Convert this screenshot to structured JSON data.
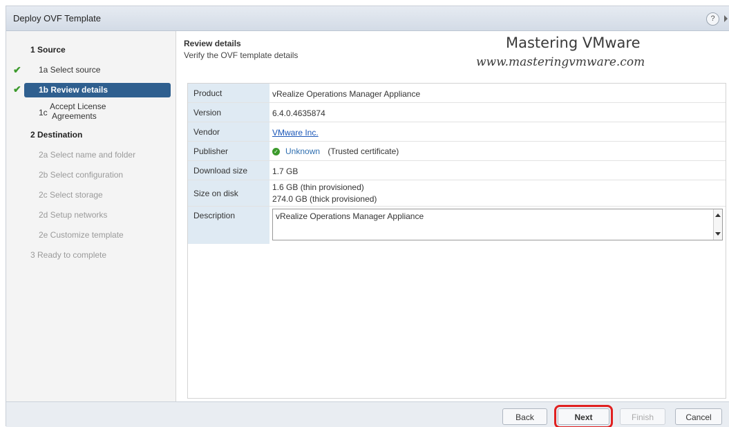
{
  "window": {
    "title": "Deploy OVF Template",
    "help_icon": "?"
  },
  "sidebar": {
    "items": [
      {
        "label": "1 Source",
        "checked": false,
        "state": "section"
      },
      {
        "label": "1a Select source",
        "checked": true,
        "state": "done"
      },
      {
        "label": "1b Review details",
        "checked": true,
        "state": "selected"
      },
      {
        "label_prefix": "1c",
        "label_line1": "Accept License",
        "label_line2": "Agreements",
        "checked": false,
        "state": "active"
      },
      {
        "label": "2 Destination",
        "checked": false,
        "state": "section"
      },
      {
        "label": "2a Select name and folder",
        "state": "disabled"
      },
      {
        "label": "2b Select configuration",
        "state": "disabled"
      },
      {
        "label": "2c Select storage",
        "state": "disabled"
      },
      {
        "label": "2d Setup networks",
        "state": "disabled"
      },
      {
        "label": "2e Customize template",
        "state": "disabled"
      },
      {
        "label": "3 Ready to complete",
        "state": "section-disabled"
      }
    ],
    "check_glyph": "✔"
  },
  "main": {
    "title": "Review details",
    "subtitle": "Verify the OVF template details",
    "watermark_line1": "Mastering VMware",
    "watermark_line2": "www.masteringvmware.com",
    "details": {
      "product": {
        "label": "Product",
        "value": "vRealize Operations Manager Appliance"
      },
      "version": {
        "label": "Version",
        "value": "6.4.0.4635874"
      },
      "vendor": {
        "label": "Vendor",
        "value": "VMware Inc."
      },
      "publisher": {
        "label": "Publisher",
        "value": "Unknown",
        "note": "(Trusted certificate)"
      },
      "download_size": {
        "label": "Download size",
        "value": "1.7 GB"
      },
      "size_on_disk": {
        "label": "Size on disk",
        "value_line1": "1.6 GB (thin provisioned)",
        "value_line2": "274.0 GB (thick provisioned)"
      },
      "description": {
        "label": "Description",
        "value": "vRealize Operations Manager Appliance"
      }
    }
  },
  "footer": {
    "back": "Back",
    "next": "Next",
    "finish": "Finish",
    "cancel": "Cancel"
  },
  "colors": {
    "accent": "#2f5f8f",
    "check": "#3c9a2c",
    "highlight": "#e02020",
    "label_bg": "#dfeaf3"
  }
}
